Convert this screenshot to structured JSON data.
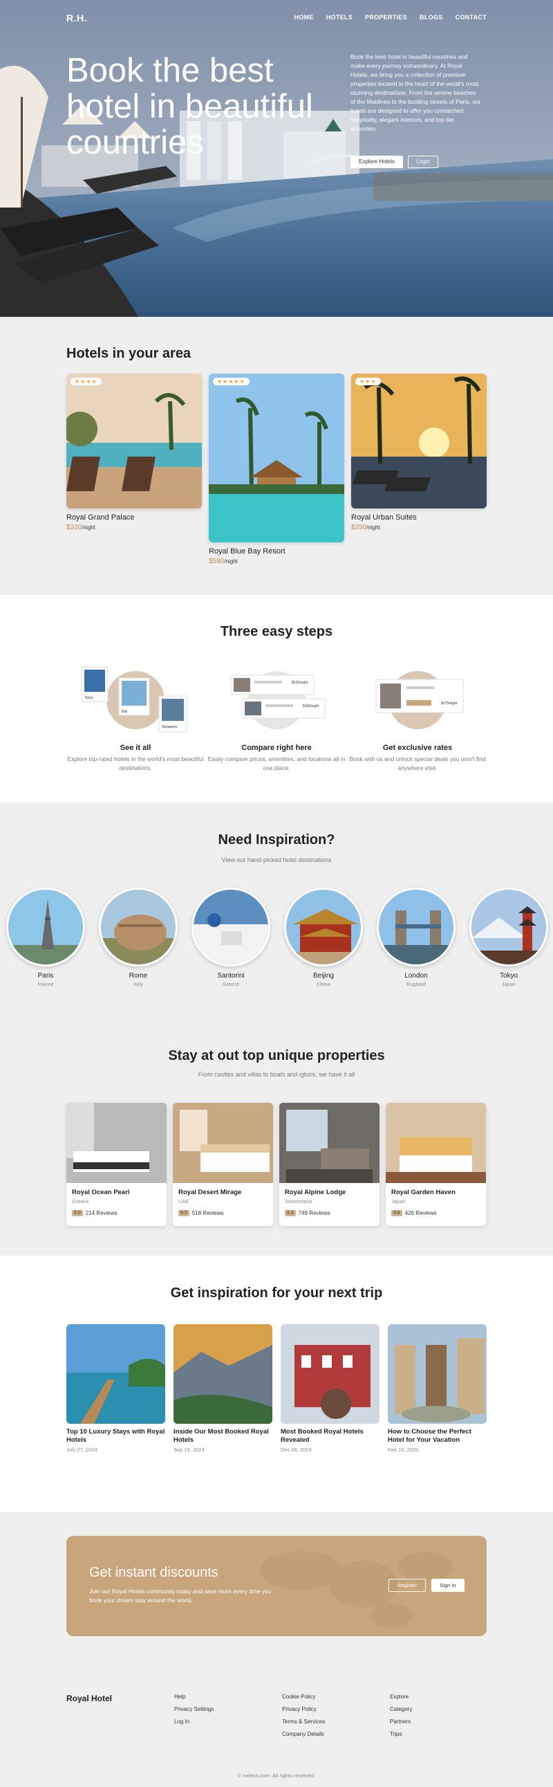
{
  "nav": {
    "logo": "R.H.",
    "links": [
      "HOME",
      "HOTELS",
      "PROPERTIES",
      "BLOGS",
      "CONTACT"
    ]
  },
  "hero": {
    "title": "Book the best hotel in beautiful countries",
    "description": "Book the best hotel in beautiful countries and make every journey extraordinary. At Royal Hotels, we bring you a collection of premium properties located in the heart of the world's most stunning destinations. From the serene beaches of the Maldives to the bustling streets of Paris, our hotels are designed to offer you unmatched hospitality, elegant interiors, and top-tier amenities.",
    "primary_button": "Explore Hotels",
    "secondary_button": "Login"
  },
  "area": {
    "title": "Hotels in your area",
    "hotels": [
      {
        "name": "Royal Grand Palace",
        "price": "$320",
        "per": "/night",
        "stars": "★★★★"
      },
      {
        "name": "Royal Blue Bay Resort",
        "price": "$580",
        "per": "/night",
        "stars": "★★★★★"
      },
      {
        "name": "Royal Urban Suites",
        "price": "$350",
        "per": "/night",
        "stars": "★★★"
      }
    ]
  },
  "steps": {
    "title": "Three easy steps",
    "items": [
      {
        "title": "See it all",
        "desc": "Explore top-rated hotels in the world's most beautiful destinations.",
        "labels": [
          "Tokyo",
          "Bali",
          "Singapore"
        ]
      },
      {
        "title": "Compare right here",
        "desc": "Easily compare prices, amenities, and locations all in one place.",
        "labels": [
          "$225/night",
          "$190/night"
        ]
      },
      {
        "title": "Get exclusive rates",
        "desc": "Book with us and unlock special deals you won't find anywhere else.",
        "labels": [
          "$175/night"
        ]
      }
    ]
  },
  "inspiration": {
    "title": "Need Inspiration?",
    "subtitle": "View our hand-picked hotel destinations",
    "cities": [
      {
        "name": "Paris",
        "country": "France"
      },
      {
        "name": "Rome",
        "country": "Italy"
      },
      {
        "name": "Santorini",
        "country": "Greece"
      },
      {
        "name": "Beijing",
        "country": "China"
      },
      {
        "name": "London",
        "country": "England"
      },
      {
        "name": "Tokyo",
        "country": "Japan"
      }
    ]
  },
  "properties": {
    "title": "Stay at out top unique properties",
    "subtitle": "From castles and villas to boats and igloos, we have it all",
    "items": [
      {
        "name": "Royal Ocean Pearl",
        "location": "Greece",
        "score": "9.0",
        "reviews": "214 Reviews"
      },
      {
        "name": "Royal Desert Mirage",
        "location": "UAE",
        "score": "9.5",
        "reviews": "518 Reviews"
      },
      {
        "name": "Royal Alpine Lodge",
        "location": "Switzerland",
        "score": "9.3",
        "reviews": "749 Reviews"
      },
      {
        "name": "Royal Garden Haven",
        "location": "Japan",
        "score": "9.8",
        "reviews": "426 Reviews"
      }
    ]
  },
  "blog": {
    "title": "Get inspiration for your next trip",
    "posts": [
      {
        "title": "Top 10 Luxury Stays with Royal Hotels",
        "date": "July 27, 2024"
      },
      {
        "title": "Inside Our Most Booked Royal Hotels",
        "date": "Sep 15, 2024"
      },
      {
        "title": "Most Booked Royal Hotels Revealed",
        "date": "Dec 09, 2024"
      },
      {
        "title": "How to Choose the Perfect Hotel for Your Vacation",
        "date": "Feb 18, 2025"
      }
    ]
  },
  "discount": {
    "title": "Get instant discounts",
    "desc": "Join our Royal Hotels community today and save more every time you book your dream stay around the world.",
    "register": "Register",
    "signin": "Sign In"
  },
  "footer": {
    "brand": "Royal Hotel",
    "col1": [
      "Help",
      "Privacy Settings",
      "Log In"
    ],
    "col2": [
      "Cookie Policy",
      "Privacy Policy",
      "Terms & Services",
      "Company Details"
    ],
    "col3": [
      "Explore",
      "Category",
      "Partners",
      "Trips"
    ],
    "copyright": "© rodevs.com. All rights reserved."
  },
  "colors": {
    "accent": "#c58a4a",
    "banner": "#c9a57c",
    "page_bg": "#f0efef"
  }
}
